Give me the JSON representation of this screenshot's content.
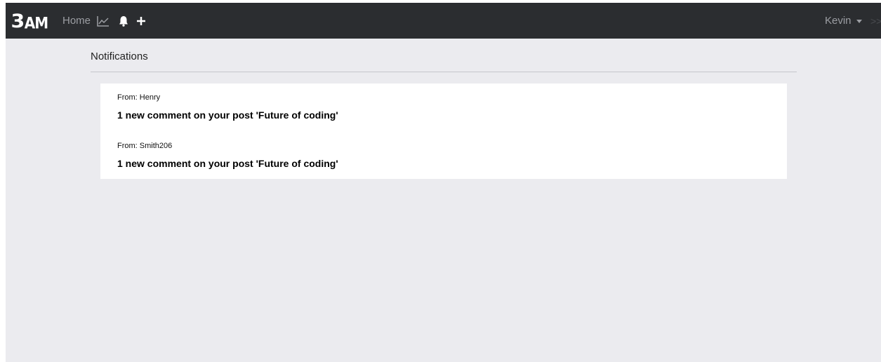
{
  "navbar": {
    "logo_number": "3",
    "logo_letters": "AM",
    "home_label": "Home",
    "icons": [
      "chart-line-icon",
      "bell-icon",
      "plus-icon"
    ],
    "user_name": "Kevin",
    "colors": {
      "bar": "#2b2d30",
      "link": "#9c9ea3",
      "logo": "#ffffff"
    }
  },
  "page": {
    "title": "Notifications",
    "background": "#ebebef"
  },
  "notifications": [
    {
      "from": "From: Henry",
      "message": "1 new comment on your post 'Future of coding'"
    },
    {
      "from": "From: Smith206",
      "message": "1 new comment on your post 'Future of coding'"
    }
  ]
}
